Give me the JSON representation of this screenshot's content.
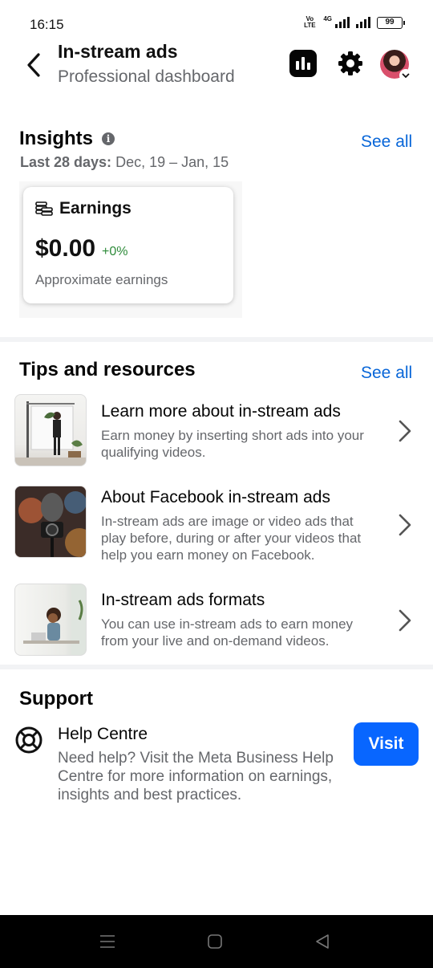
{
  "status_bar": {
    "time": "16:15",
    "volte_label": "VoLTE",
    "network_label": "4G",
    "battery_level": "99"
  },
  "header": {
    "title": "In-stream ads",
    "subtitle": "Professional dashboard"
  },
  "insights": {
    "title": "Insights",
    "see_all": "See all",
    "range_label": "Last 28 days:",
    "range_value": "Dec, 19 – Jan, 15",
    "earnings_card": {
      "label": "Earnings",
      "value": "$0.00",
      "change": "+0%",
      "description": "Approximate earnings"
    }
  },
  "tips": {
    "title": "Tips and resources",
    "see_all": "See all",
    "items": [
      {
        "title": "Learn more about in-stream ads",
        "description": "Earn money by inserting short ads into your qualifying videos."
      },
      {
        "title": "About Facebook in-stream ads",
        "description": "In-stream ads are image or video ads that play before, during or after your videos that help you earn money on Facebook."
      },
      {
        "title": "In-stream ads formats",
        "description": "You can use in-stream ads to earn money from your live and on-demand videos."
      }
    ]
  },
  "support": {
    "title": "Support",
    "help_title": "Help Centre",
    "help_description": "Need help? Visit the Meta Business Help Centre for more information on earnings, insights and best practices.",
    "visit_label": "Visit"
  },
  "colors": {
    "accent_link": "#0866d8",
    "primary_button": "#0866ff",
    "positive_change": "#2e8b3a",
    "secondary_text": "#65676b"
  },
  "icons": {
    "back": "chevron-left-icon",
    "insights": "bar-chart-icon",
    "settings": "gear-icon",
    "info": "info-icon",
    "earnings": "coins-stack-icon",
    "tip_chevron": "chevron-right-icon",
    "help": "lifebuoy-icon",
    "nav_menu": "menu-icon",
    "nav_home": "home-square-icon",
    "nav_back": "back-triangle-icon"
  }
}
